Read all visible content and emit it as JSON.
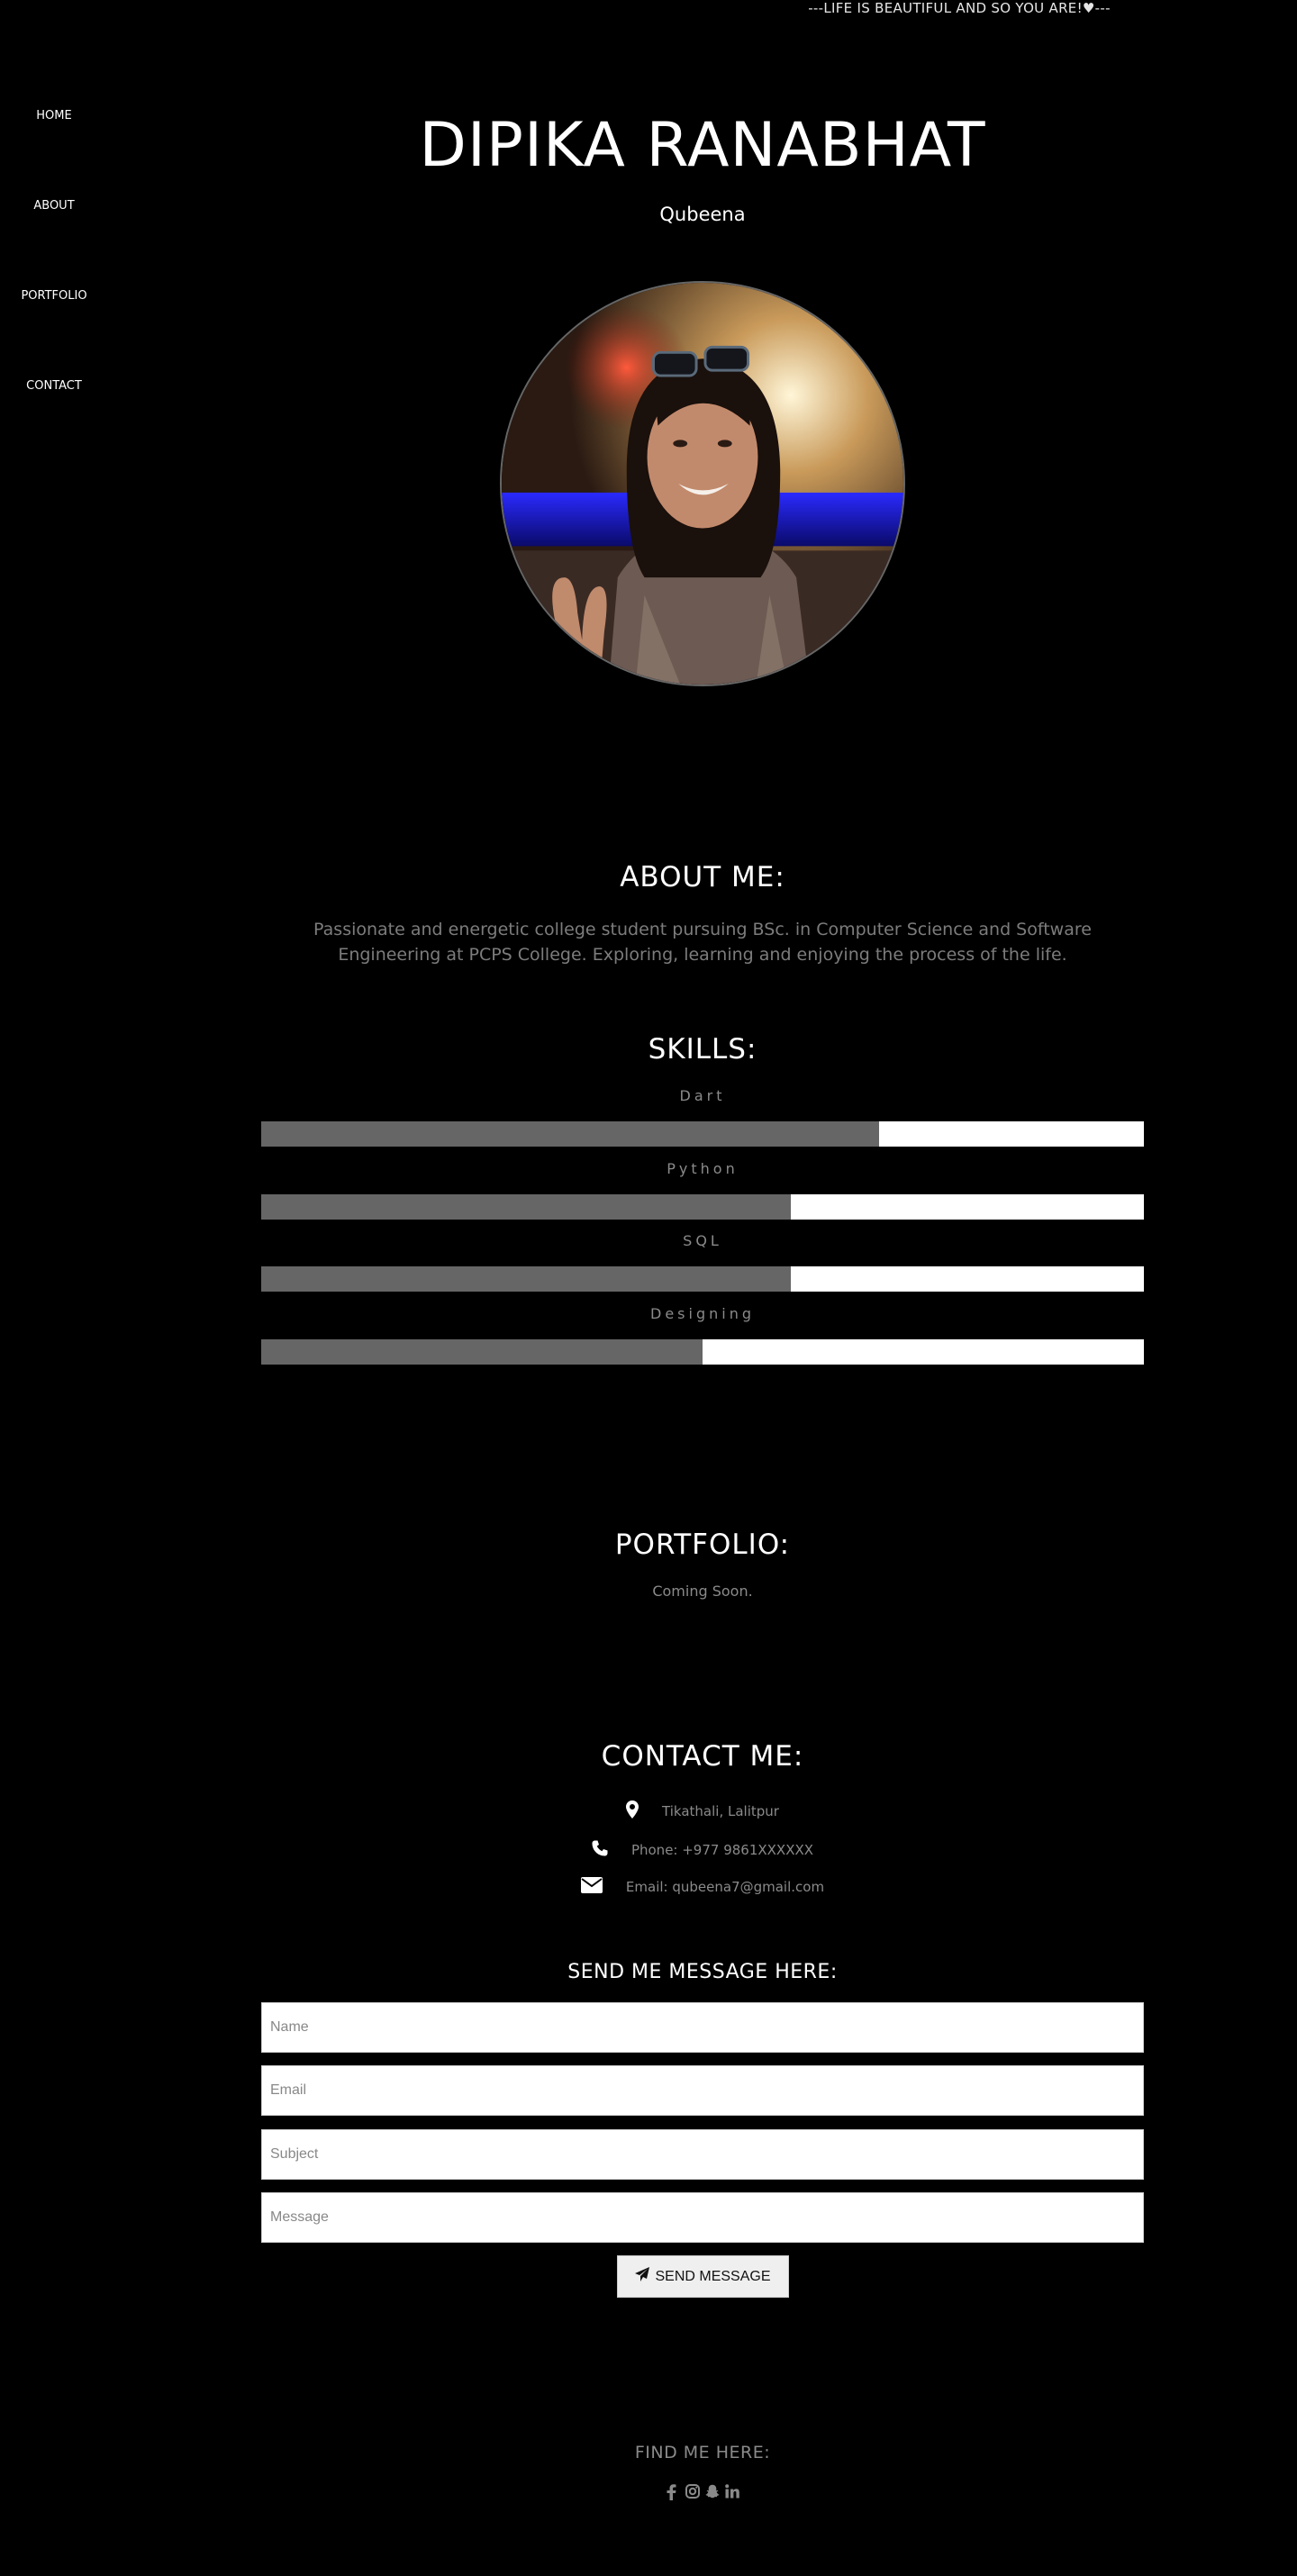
{
  "header": {
    "tagline": "---LIFE IS BEAUTIFUL AND SO YOU ARE!♥---"
  },
  "nav": {
    "items": [
      {
        "label": "HOME"
      },
      {
        "label": "ABOUT"
      },
      {
        "label": "PORTFOLIO"
      },
      {
        "label": "CONTACT"
      }
    ]
  },
  "hero": {
    "name": "DIPIKA RANABHAT",
    "nickname": "Qubeena",
    "avatar_icon": "profile-photo"
  },
  "about": {
    "title": "ABOUT ME:",
    "text": "Passionate and energetic college student pursuing BSc. in Computer Science and Software Engineering at PCPS College. Exploring, learning and enjoying the process of the life."
  },
  "skills": {
    "title": "SKILLS:",
    "items": [
      {
        "label": "Dart",
        "level": 0.7
      },
      {
        "label": "Python",
        "level": 0.6
      },
      {
        "label": "SQL",
        "level": 0.6
      },
      {
        "label": "Designing",
        "level": 0.5
      }
    ],
    "colors": {
      "fill": "#666666",
      "track": "#ffffff"
    }
  },
  "portfolio": {
    "title": "PORTFOLIO:",
    "note": "Coming Soon."
  },
  "contact": {
    "title": "CONTACT ME:",
    "address": "Tikathali, Lalitpur",
    "phone": "Phone: +977 9861XXXXXX",
    "email": "Email: qubeena7@gmail.com"
  },
  "form": {
    "heading": "SEND ME MESSAGE HERE:",
    "name_placeholder": "Name",
    "email_placeholder": "Email",
    "subject_placeholder": "Subject",
    "message_placeholder": "Message",
    "send_label": "SEND MESSAGE"
  },
  "footer": {
    "heading": "FIND ME HERE:",
    "social_icons": [
      "facebook-icon",
      "instagram-icon",
      "snapchat-icon",
      "linkedin-icon"
    ]
  }
}
